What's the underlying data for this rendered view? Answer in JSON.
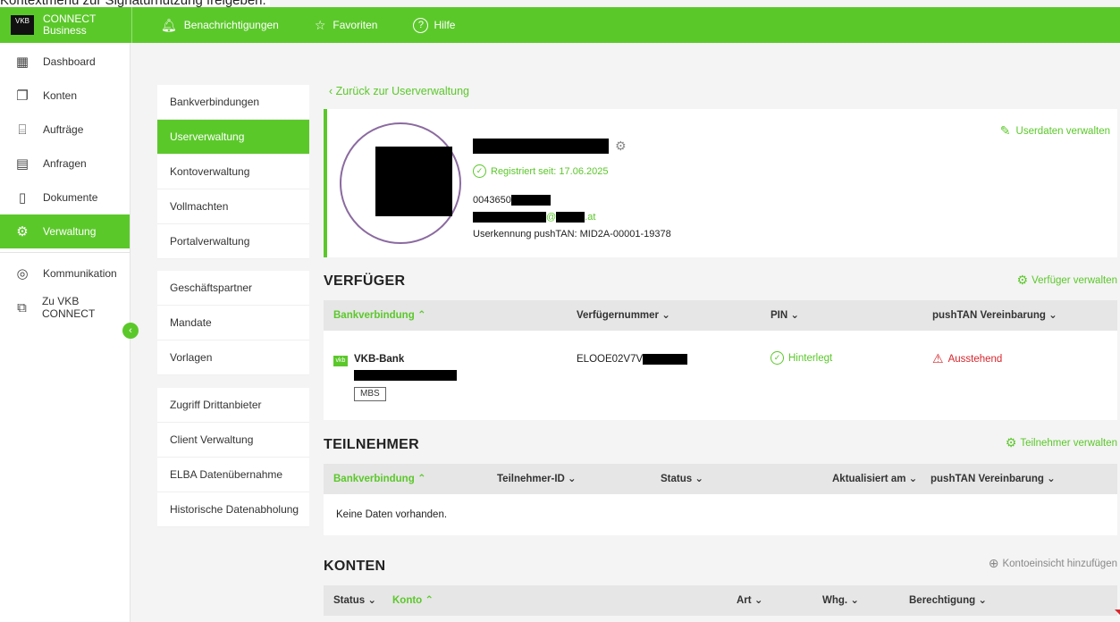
{
  "overlay_text": "Kontextmenü zur Signaturnutzung freigeben.",
  "brand": {
    "logo": "VKB",
    "line1": "CONNECT",
    "line2": "Business"
  },
  "topnav": {
    "notifications": "Benachrichtigungen",
    "favorites": "Favoriten",
    "help": "Hilfe"
  },
  "sidebar": {
    "items": [
      {
        "label": "Dashboard",
        "icon": "dashboard-icon"
      },
      {
        "label": "Konten",
        "icon": "cards-icon"
      },
      {
        "label": "Aufträge",
        "icon": "orders-icon"
      },
      {
        "label": "Anfragen",
        "icon": "requests-icon"
      },
      {
        "label": "Dokumente",
        "icon": "document-icon"
      },
      {
        "label": "Verwaltung",
        "icon": "gear-icon"
      },
      {
        "label": "Kommunikation",
        "icon": "chat-icon"
      },
      {
        "label": "Zu VKB CONNECT",
        "icon": "external-link-icon"
      }
    ]
  },
  "subnav": {
    "group1": [
      "Bankverbindungen",
      "Userverwaltung",
      "Kontoverwaltung",
      "Vollmachten",
      "Portalverwaltung"
    ],
    "group2": [
      "Geschäftspartner",
      "Mandate",
      "Vorlagen"
    ],
    "group3": [
      "Zugriff Drittanbieter",
      "Client Verwaltung",
      "ELBA Datenübernahme",
      "Historische Datenabholung"
    ]
  },
  "back_link": "Zurück zur Userverwaltung",
  "profile": {
    "registered": "Registriert seit: 17.06.2025",
    "phone_prefix": "0043650",
    "email_at": "@",
    "email_tld": ".at",
    "pushtan_id": "Userkennung pushTAN: MID2A-00001-19378",
    "manage_link": "Userdaten verwalten"
  },
  "verfueger": {
    "title": "VERFÜGER",
    "action": "Verfüger verwalten",
    "columns": [
      "Bankverbindung",
      "Verfügernummer",
      "PIN",
      "pushTAN Vereinbarung"
    ],
    "row": {
      "bank_logo": "vkb",
      "bank": "VKB-Bank",
      "badge": "MBS",
      "number_prefix": "ELOOE02V7V",
      "pin": "Hinterlegt",
      "pushtan": "Ausstehend"
    }
  },
  "teilnehmer": {
    "title": "TEILNEHMER",
    "action": "Teilnehmer verwalten",
    "columns": [
      "Bankverbindung",
      "Teilnehmer-ID",
      "Status",
      "Aktualisiert am",
      "pushTAN Vereinbarung"
    ],
    "empty": "Keine Daten vorhanden."
  },
  "konten": {
    "title": "KONTEN",
    "action": "Kontoeinsicht hinzufügen",
    "columns": [
      "Status",
      "Konto",
      "Art",
      "Whg.",
      "Berechtigung"
    ]
  },
  "colors": {
    "accent": "#5bc82a",
    "danger": "#d9262c",
    "avatar_ring": "#8b6aa0"
  }
}
